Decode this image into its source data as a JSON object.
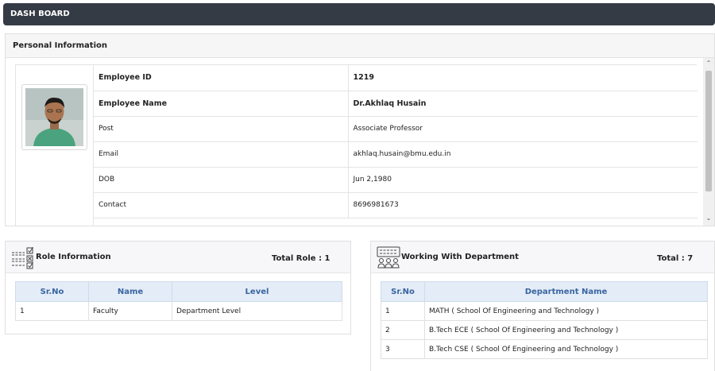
{
  "header": {
    "title": "DASH BOARD"
  },
  "personal": {
    "title": "Personal Information",
    "rows": [
      {
        "key": "Employee ID",
        "value": "1219",
        "bold": true
      },
      {
        "key": "Employee Name",
        "value": "Dr.Akhlaq Husain",
        "bold": true
      },
      {
        "key": "Post",
        "value": "Associate Professor",
        "bold": false
      },
      {
        "key": "Email",
        "value": "akhlaq.husain@bmu.edu.in",
        "bold": false
      },
      {
        "key": "DOB",
        "value": "Jun 2,1980",
        "bold": false
      },
      {
        "key": "Contact",
        "value": "8696981673",
        "bold": false
      }
    ],
    "scroll": {
      "up": "⌃",
      "down": "⌄"
    }
  },
  "role": {
    "title": "Role Information",
    "total": "Total Role : 1",
    "icon": "checklist-icon",
    "columns": [
      "Sr.No",
      "Name",
      "Level"
    ],
    "rows": [
      [
        "1",
        "Faculty",
        "Department Level"
      ]
    ]
  },
  "department": {
    "title": "Working With Department",
    "total": "Total : 7",
    "icon": "team-board-icon",
    "columns": [
      "Sr.No",
      "Department Name"
    ],
    "rows": [
      [
        "1",
        "MATH ( School Of Engineering and Technology )"
      ],
      [
        "2",
        "B.Tech ECE ( School Of Engineering and Technology )"
      ],
      [
        "3",
        "B.Tech CSE ( School Of Engineering and Technology )"
      ]
    ]
  }
}
